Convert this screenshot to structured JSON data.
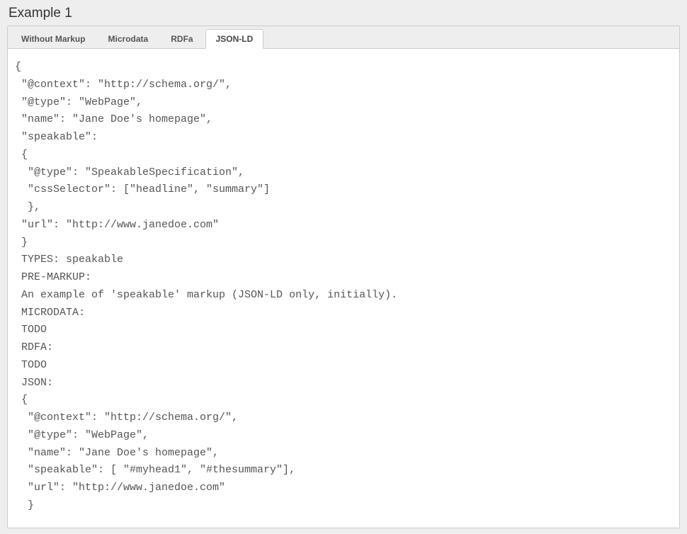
{
  "heading": "Example 1",
  "tabs": [
    {
      "label": "Without Markup",
      "active": false
    },
    {
      "label": "Microdata",
      "active": false
    },
    {
      "label": "RDFa",
      "active": false
    },
    {
      "label": "JSON-LD",
      "active": true
    }
  ],
  "code_content": "{\n \"@context\": \"http://schema.org/\",\n \"@type\": \"WebPage\",\n \"name\": \"Jane Doe's homepage\",\n \"speakable\":\n {\n  \"@type\": \"SpeakableSpecification\",\n  \"cssSelector\": [\"headline\", \"summary\"]\n  },\n \"url\": \"http://www.janedoe.com\"\n }\n TYPES: speakable\n PRE-MARKUP:\n An example of 'speakable' markup (JSON-LD only, initially).\n MICRODATA:\n TODO\n RDFA:\n TODO\n JSON:\n {\n  \"@context\": \"http://schema.org/\",\n  \"@type\": \"WebPage\",\n  \"name\": \"Jane Doe's homepage\",\n  \"speakable\": [ \"#myhead1\", \"#thesummary\"],\n  \"url\": \"http://www.janedoe.com\"\n  }"
}
